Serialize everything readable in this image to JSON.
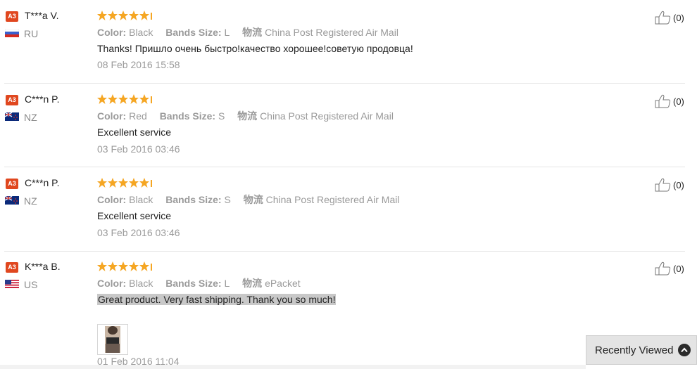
{
  "reviews": [
    {
      "badge": "A3",
      "user": "T***a V.",
      "country": "RU",
      "flag": "flag-ru",
      "rating": 5,
      "color_label": "Color:",
      "color": "Black",
      "size_label": "Bands Size:",
      "size": "L",
      "ship_label": "物流",
      "shipping": "China Post Registered Air Mail",
      "text": "Thanks! Пришло очень быстро!качество хорошее!советую продовца!",
      "date": "08 Feb 2016 15:58",
      "helpful": "(0)"
    },
    {
      "badge": "A3",
      "user": "C***n P.",
      "country": "NZ",
      "flag": "flag-nz",
      "rating": 5,
      "color_label": "Color:",
      "color": "Red",
      "size_label": "Bands Size:",
      "size": "S",
      "ship_label": "物流",
      "shipping": "China Post Registered Air Mail",
      "text": "Excellent service",
      "date": "03 Feb 2016 03:46",
      "helpful": "(0)"
    },
    {
      "badge": "A3",
      "user": "C***n P.",
      "country": "NZ",
      "flag": "flag-nz",
      "rating": 5,
      "color_label": "Color:",
      "color": "Black",
      "size_label": "Bands Size:",
      "size": "S",
      "ship_label": "物流",
      "shipping": "China Post Registered Air Mail",
      "text": "Excellent service",
      "date": "03 Feb 2016 03:46",
      "helpful": "(0)"
    },
    {
      "badge": "A3",
      "user": "K***a B.",
      "country": "US",
      "flag": "flag-us",
      "rating": 5,
      "color_label": "Color:",
      "color": "Black",
      "size_label": "Bands Size:",
      "size": "L",
      "ship_label": "物流",
      "shipping": "ePacket",
      "text": "Great product. Very fast shipping. Thank you so much!",
      "date": "01 Feb 2016 11:04",
      "helpful": "(0)",
      "has_photo": true
    }
  ],
  "recently_viewed": {
    "label": "Recently Viewed",
    "icon": "chevron-up-icon"
  },
  "colors": {
    "badge": "#e0471f",
    "star": "#f5a623",
    "muted": "#9a9a9a",
    "highlight": "#c8c8c8"
  }
}
